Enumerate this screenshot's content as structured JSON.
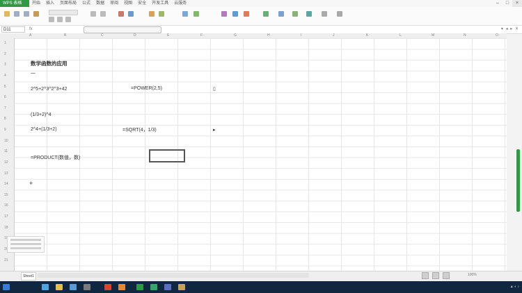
{
  "app": {
    "name": "WPS 表格",
    "menu_tabs": [
      "开始",
      "插入",
      "页面布局",
      "公式",
      "数据",
      "审阅",
      "视图",
      "安全",
      "开发工具",
      "云服务"
    ]
  },
  "formula_bar": {
    "cell_ref": "D11",
    "fx": "fx"
  },
  "columns": [
    "A",
    "B",
    "C",
    "D",
    "E",
    "F",
    "G",
    "H",
    "I",
    "J",
    "K",
    "L",
    "M",
    "N",
    "O"
  ],
  "rows": [
    "1",
    "2",
    "3",
    "4",
    "5",
    "6",
    "7",
    "8",
    "9",
    "10",
    "11",
    "12",
    "13",
    "14",
    "15",
    "16",
    "17",
    "18",
    "19",
    "20",
    "21"
  ],
  "cells": {
    "title": "数学函数的应用",
    "r3_note": "一",
    "formula1": "2^5+2^3^2^3+42",
    "power_func": "=POWER(2,5)",
    "formula2": "(1/3+2)^4",
    "formula3": "2^4+(1/3+2)",
    "sqrt_func": "=SQRT(4，1/3)",
    "product_func": "=PRODUCT(数值，数)",
    "plus_sign": "+"
  },
  "sheet_tabs": [
    "Sheet1"
  ],
  "zoom": "100%",
  "colors": {
    "accent": "#2e9a44",
    "taskbar": "#0f2840"
  }
}
